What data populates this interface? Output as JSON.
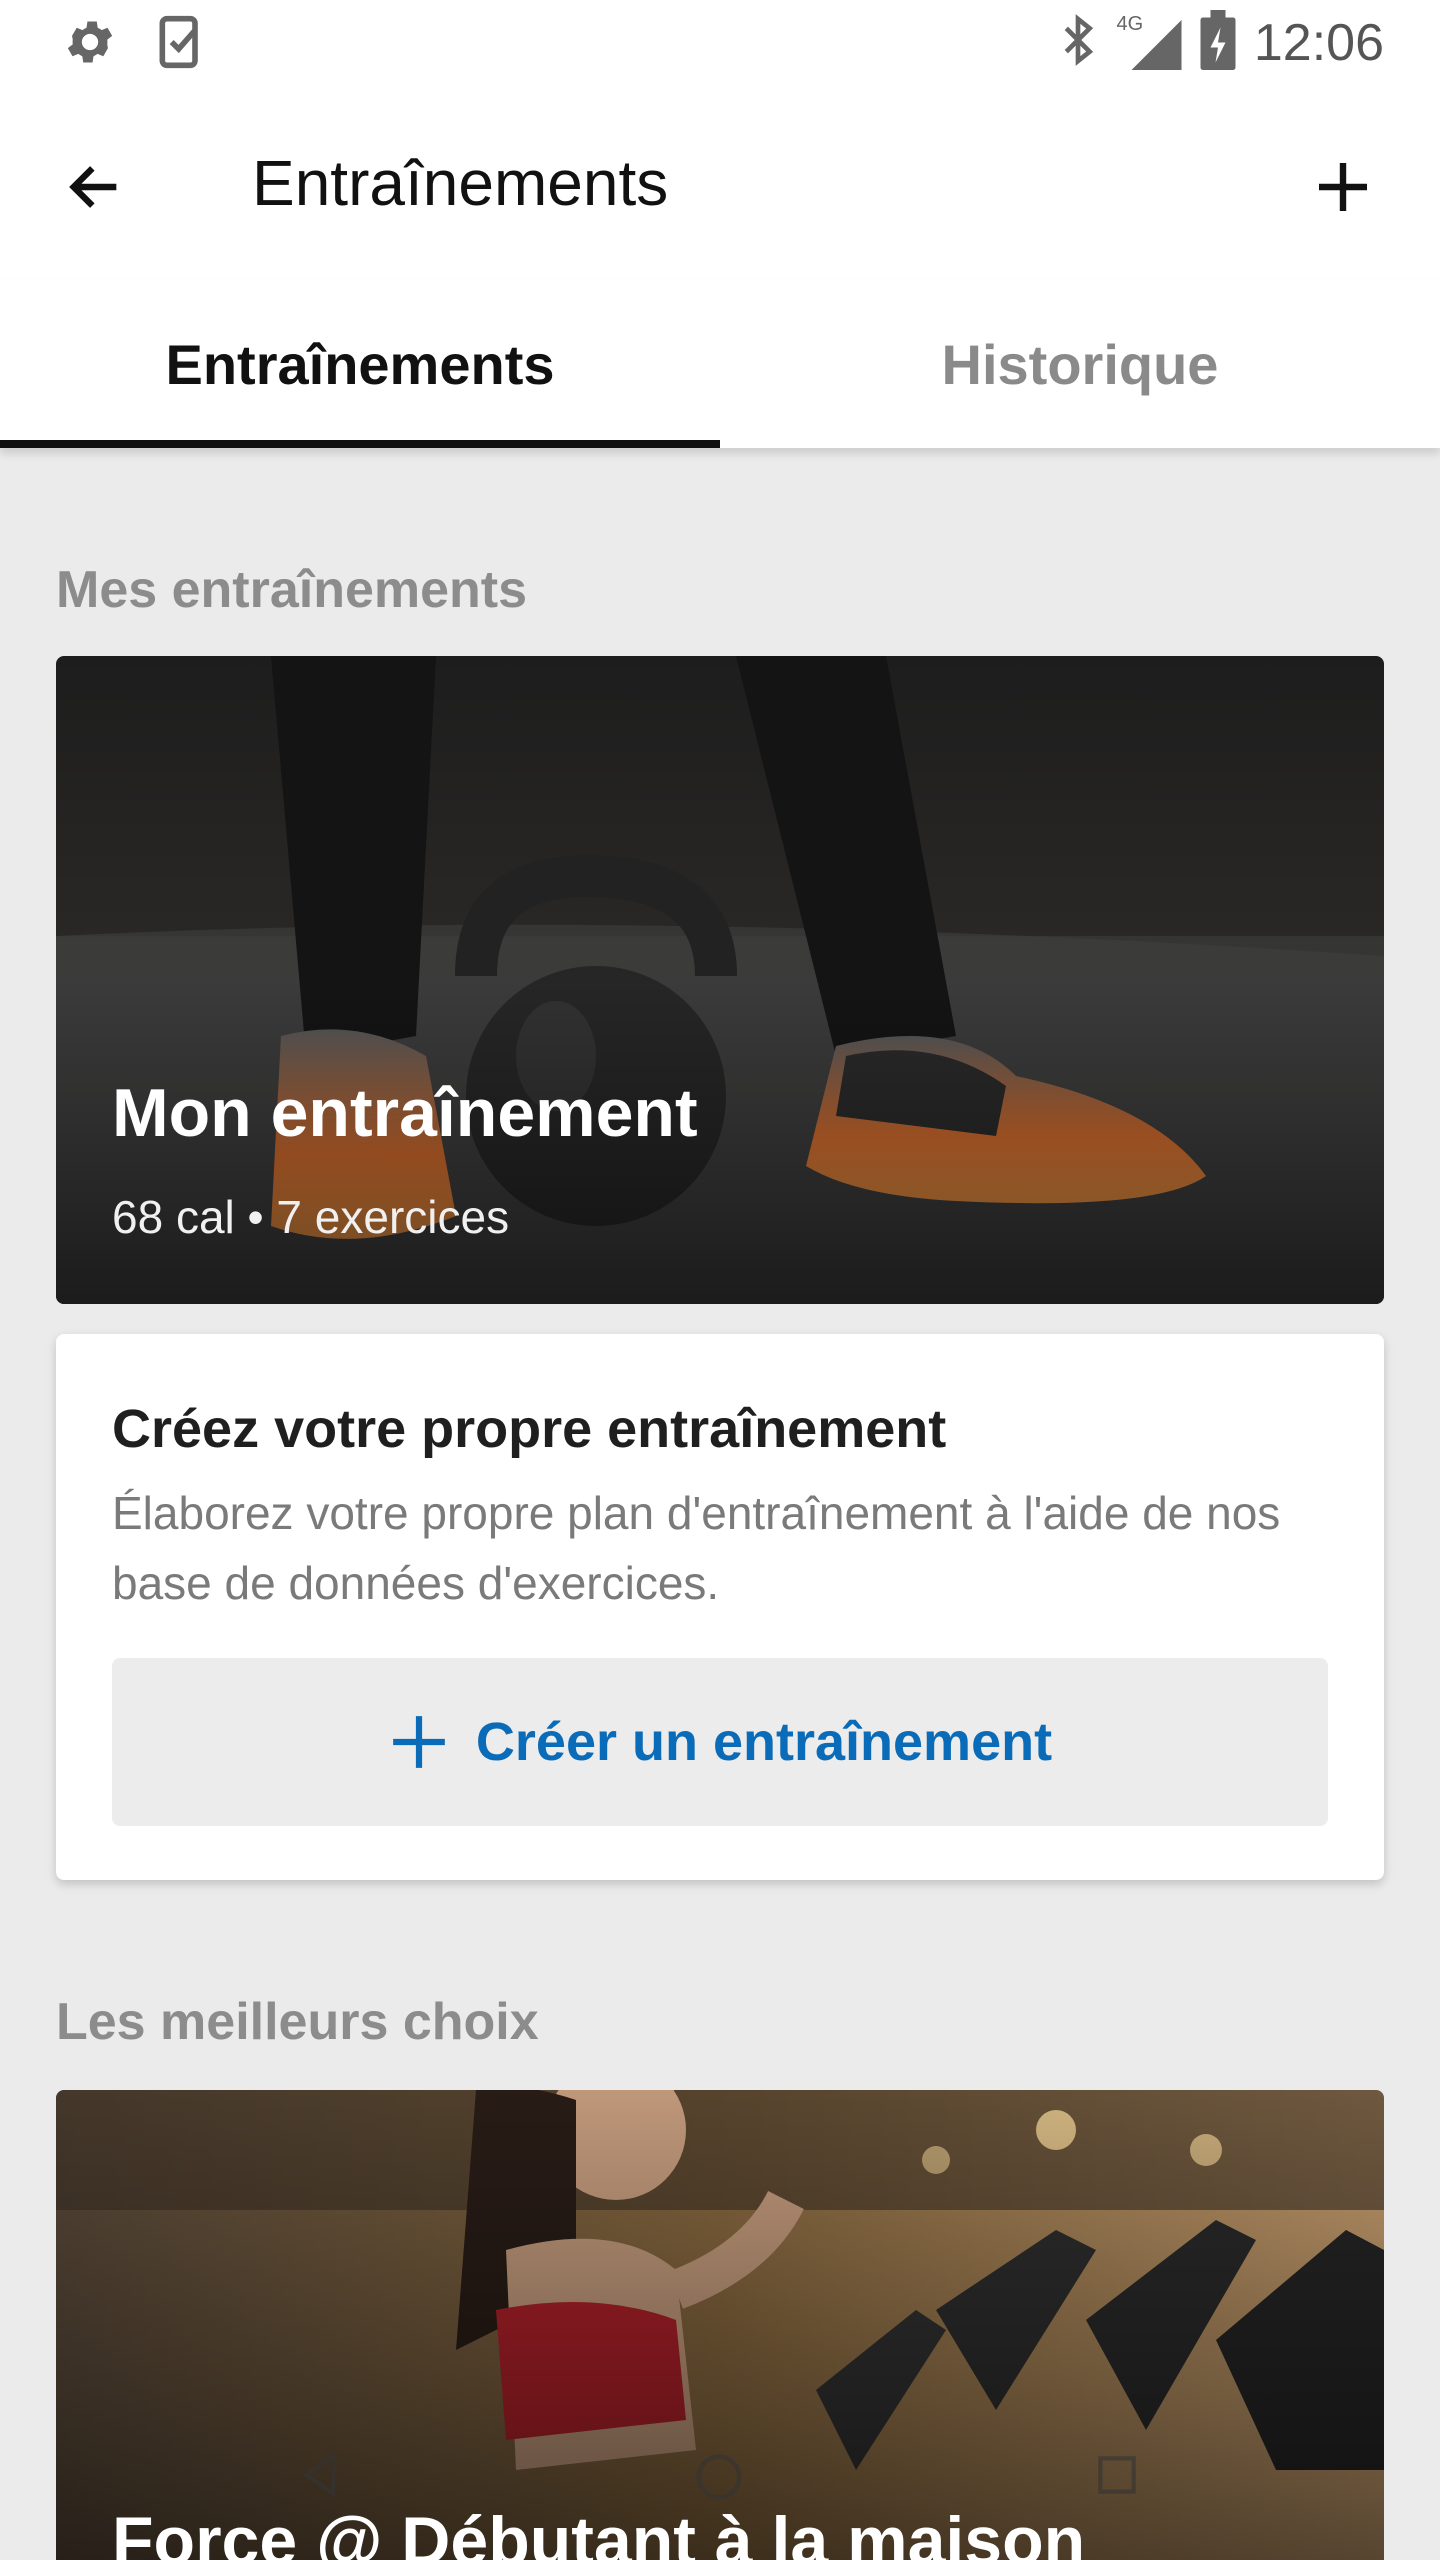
{
  "status_bar": {
    "time": "12:06",
    "left_icons": [
      "gear-icon",
      "task-check-icon"
    ],
    "right_icons": [
      "bluetooth-icon",
      "signal-4g-icon",
      "battery-charging-icon"
    ],
    "network_label": "4G"
  },
  "app_bar": {
    "title": "Entraînements",
    "back_icon": "arrow-back-icon",
    "add_icon": "plus-icon"
  },
  "tabs": [
    {
      "label": "Entraînements",
      "active": true
    },
    {
      "label": "Historique",
      "active": false
    }
  ],
  "sections": {
    "my_workouts": {
      "title": "Mes entraînements",
      "card": {
        "title": "Mon entraînement",
        "subtitle": "68 cal • 7 exercices"
      },
      "create_card": {
        "title": "Créez votre propre entraînement",
        "description": "Élaborez votre propre plan d'entraînement à l'aide de nos base de données d'exercices.",
        "button_label": "Créer un entraînement",
        "button_icon": "plus-icon"
      }
    },
    "top_picks": {
      "title": "Les meilleurs choix",
      "card": {
        "title": "Force @ Débutant à la maison"
      }
    }
  },
  "nav_bar": {
    "icons": [
      "back-triangle-icon",
      "home-circle-icon",
      "recents-square-icon"
    ]
  },
  "colors": {
    "accent": "#0a6bb8",
    "background": "#ebebeb",
    "tab_indicator": "#111111"
  }
}
